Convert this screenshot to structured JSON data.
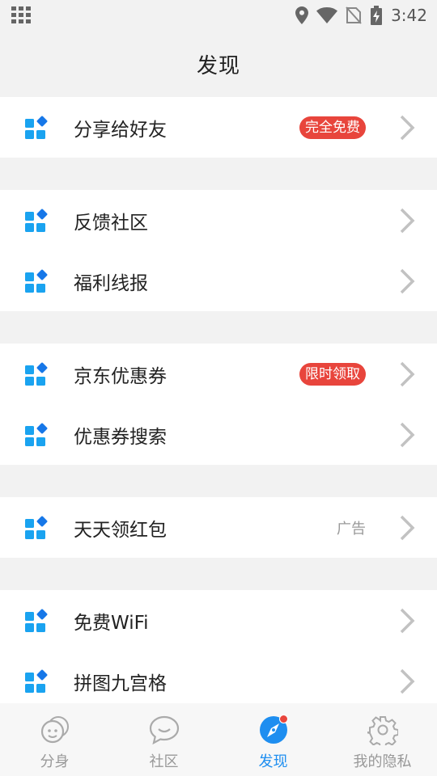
{
  "status_bar": {
    "time": "3:42",
    "icons": [
      "grid-icon",
      "location-icon",
      "wifi-icon",
      "no-sim-icon",
      "battery-charging-icon"
    ]
  },
  "header": {
    "title": "发现"
  },
  "colors": {
    "accent": "#1e8ef0",
    "badge": "#e8453c",
    "icon_blue": "#1aa3f0",
    "icon_dark": "#1677e8"
  },
  "sections": [
    {
      "rows": [
        {
          "label": "分享给好友",
          "badge": "完全免费",
          "icon": "app-grid-icon"
        }
      ]
    },
    {
      "rows": [
        {
          "label": "反馈社区",
          "icon": "app-grid-icon"
        },
        {
          "label": "福利线报",
          "icon": "app-grid-icon"
        }
      ]
    },
    {
      "rows": [
        {
          "label": "京东优惠券",
          "badge": "限时领取",
          "icon": "app-grid-icon"
        },
        {
          "label": "优惠券搜索",
          "icon": "app-grid-icon"
        }
      ]
    },
    {
      "rows": [
        {
          "label": "天天领红包",
          "tag": "广告",
          "icon": "app-grid-icon"
        }
      ]
    },
    {
      "rows": [
        {
          "label": "免费WiFi",
          "icon": "app-grid-icon"
        },
        {
          "label": "拼图九宫格",
          "icon": "app-grid-icon"
        }
      ]
    }
  ],
  "tabs": [
    {
      "label": "分身",
      "icon": "clone-face-icon",
      "active": false
    },
    {
      "label": "社区",
      "icon": "chat-bubble-icon",
      "active": false
    },
    {
      "label": "发现",
      "icon": "compass-icon",
      "active": true,
      "notification_dot": true
    },
    {
      "label": "我的隐私",
      "icon": "gear-icon",
      "active": false
    }
  ]
}
